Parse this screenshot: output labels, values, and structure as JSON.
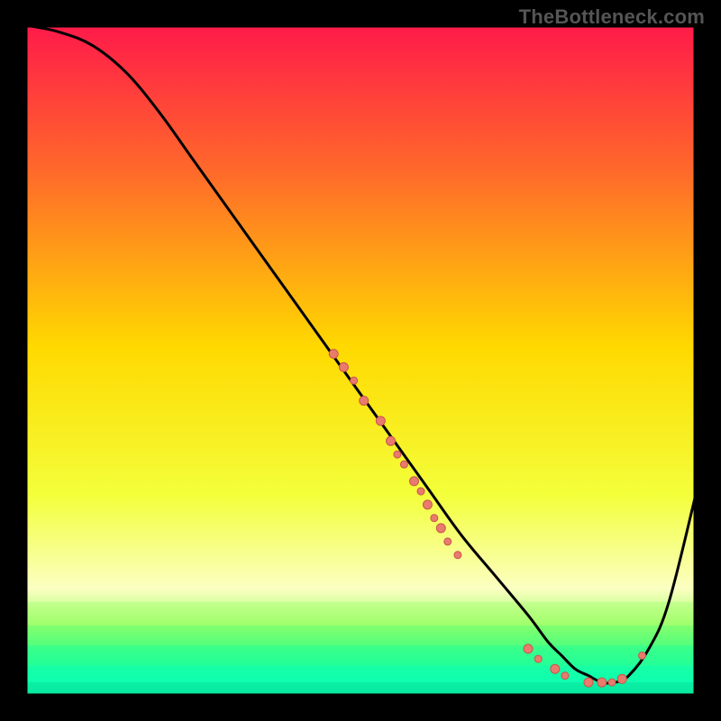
{
  "watermark": "TheBottleneck.com",
  "colors": {
    "bg": "#000000",
    "frame": "#000000",
    "curve": "#000000",
    "dot_fill": "#e97a6e",
    "dot_stroke": "#c9564b",
    "gradient": {
      "top": "#ff1a4a",
      "q1": "#ff6a2a",
      "mid": "#ffd900",
      "q3": "#f3ff3a",
      "low_yellow": "#fbffc2",
      "green1": "#9bff66",
      "green2": "#4dff80",
      "green3": "#1fff9a",
      "green4": "#0effb0",
      "green5": "#08e8a0"
    }
  },
  "chart_data": {
    "type": "line",
    "title": "",
    "xlabel": "",
    "ylabel": "",
    "xlim": [
      0,
      100
    ],
    "ylim": [
      0,
      100
    ],
    "grid": false,
    "series": [
      {
        "name": "curve",
        "x": [
          0,
          5,
          10,
          15,
          20,
          25,
          30,
          35,
          40,
          45,
          50,
          55,
          60,
          65,
          70,
          75,
          78,
          80,
          82,
          84,
          86,
          88,
          90,
          93,
          96,
          100
        ],
        "y": [
          100,
          99,
          97,
          93,
          87,
          80,
          73,
          66,
          59,
          52,
          45,
          38,
          31,
          24,
          18,
          12,
          8,
          6,
          4,
          3,
          2,
          2,
          3,
          7,
          14,
          30
        ]
      }
    ],
    "scatter": [
      {
        "x": 46,
        "y": 51,
        "r": 5
      },
      {
        "x": 47.5,
        "y": 49,
        "r": 5
      },
      {
        "x": 49,
        "y": 47,
        "r": 4
      },
      {
        "x": 50.5,
        "y": 44,
        "r": 5
      },
      {
        "x": 53,
        "y": 41,
        "r": 5
      },
      {
        "x": 54.5,
        "y": 38,
        "r": 5
      },
      {
        "x": 55.5,
        "y": 36,
        "r": 4
      },
      {
        "x": 56.5,
        "y": 34.5,
        "r": 4
      },
      {
        "x": 58,
        "y": 32,
        "r": 5
      },
      {
        "x": 59,
        "y": 30.5,
        "r": 4
      },
      {
        "x": 60,
        "y": 28.5,
        "r": 5
      },
      {
        "x": 61,
        "y": 26.5,
        "r": 4
      },
      {
        "x": 62,
        "y": 25,
        "r": 5
      },
      {
        "x": 63,
        "y": 23,
        "r": 4
      },
      {
        "x": 64.5,
        "y": 21,
        "r": 4
      },
      {
        "x": 75,
        "y": 7,
        "r": 5
      },
      {
        "x": 76.5,
        "y": 5.5,
        "r": 4
      },
      {
        "x": 79,
        "y": 4,
        "r": 5
      },
      {
        "x": 80.5,
        "y": 3,
        "r": 4
      },
      {
        "x": 84,
        "y": 2,
        "r": 5
      },
      {
        "x": 86,
        "y": 2,
        "r": 5
      },
      {
        "x": 87.5,
        "y": 2,
        "r": 4
      },
      {
        "x": 89,
        "y": 2.5,
        "r": 5
      },
      {
        "x": 92,
        "y": 6,
        "r": 4
      }
    ]
  }
}
